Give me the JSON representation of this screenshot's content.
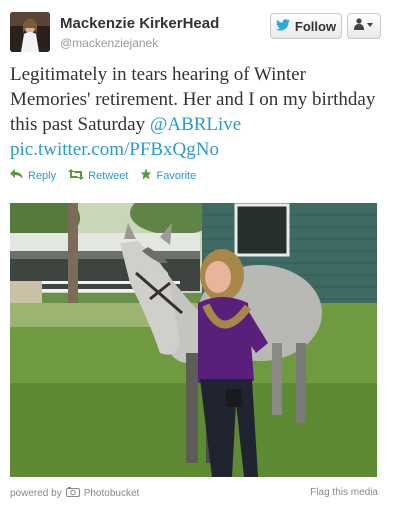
{
  "profile": {
    "name": "Mackenzie KirkerHead",
    "handle": "@mackenziejanek"
  },
  "buttons": {
    "follow_label": "Follow"
  },
  "tweet": {
    "text": "Legitimately in tears hearing of Winter Memories' retirement. Her and I on my birthday this past Saturday ",
    "mention": "@ABRLive",
    "link": "pic.twitter.com/PFBxQgNo"
  },
  "actions": {
    "reply": "Reply",
    "retweet": "Retweet",
    "favorite": "Favorite"
  },
  "footer": {
    "powered_by": "powered by",
    "service": "Photobucket",
    "flag": "Flag this media"
  },
  "colors": {
    "link": "#2a9ad0",
    "twitter_bird": "#2aa9e0"
  }
}
